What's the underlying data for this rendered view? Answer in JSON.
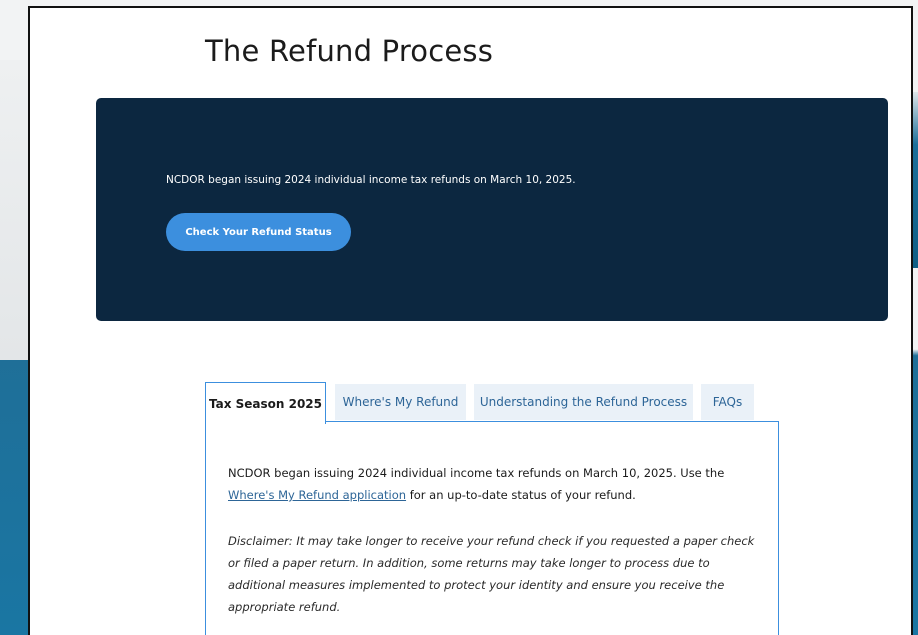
{
  "page": {
    "title": "The Refund Process"
  },
  "hero": {
    "text": "NCDOR began issuing 2024 individual income tax refunds on March 10, 2025.",
    "button_label": "Check Your Refund Status",
    "background_color": "#0c2740",
    "button_color": "#3c8fde"
  },
  "tabs": [
    {
      "label": "Tax Season 2025",
      "active": true
    },
    {
      "label": "Where's My Refund",
      "active": false
    },
    {
      "label": "Understanding the Refund Process",
      "active": false
    },
    {
      "label": "FAQs",
      "active": false
    }
  ],
  "panel": {
    "p1_before_link": "NCDOR began issuing 2024 individual income tax refunds on March 10, 2025. Use the ",
    "p1_link": "Where's My Refund application",
    "p1_after_link": " for an up-to-date status of your refund.",
    "disclaimer": "Disclaimer: It may take longer to receive your refund check if you requested a paper check or filed a paper return. In addition, some returns may take longer to process due to additional measures implemented to protect your identity and ensure you receive the appropriate refund."
  },
  "colors": {
    "link": "#2d6597",
    "tab_border": "#3c8fde",
    "inactive_tab_bg": "#eaf1f8"
  }
}
